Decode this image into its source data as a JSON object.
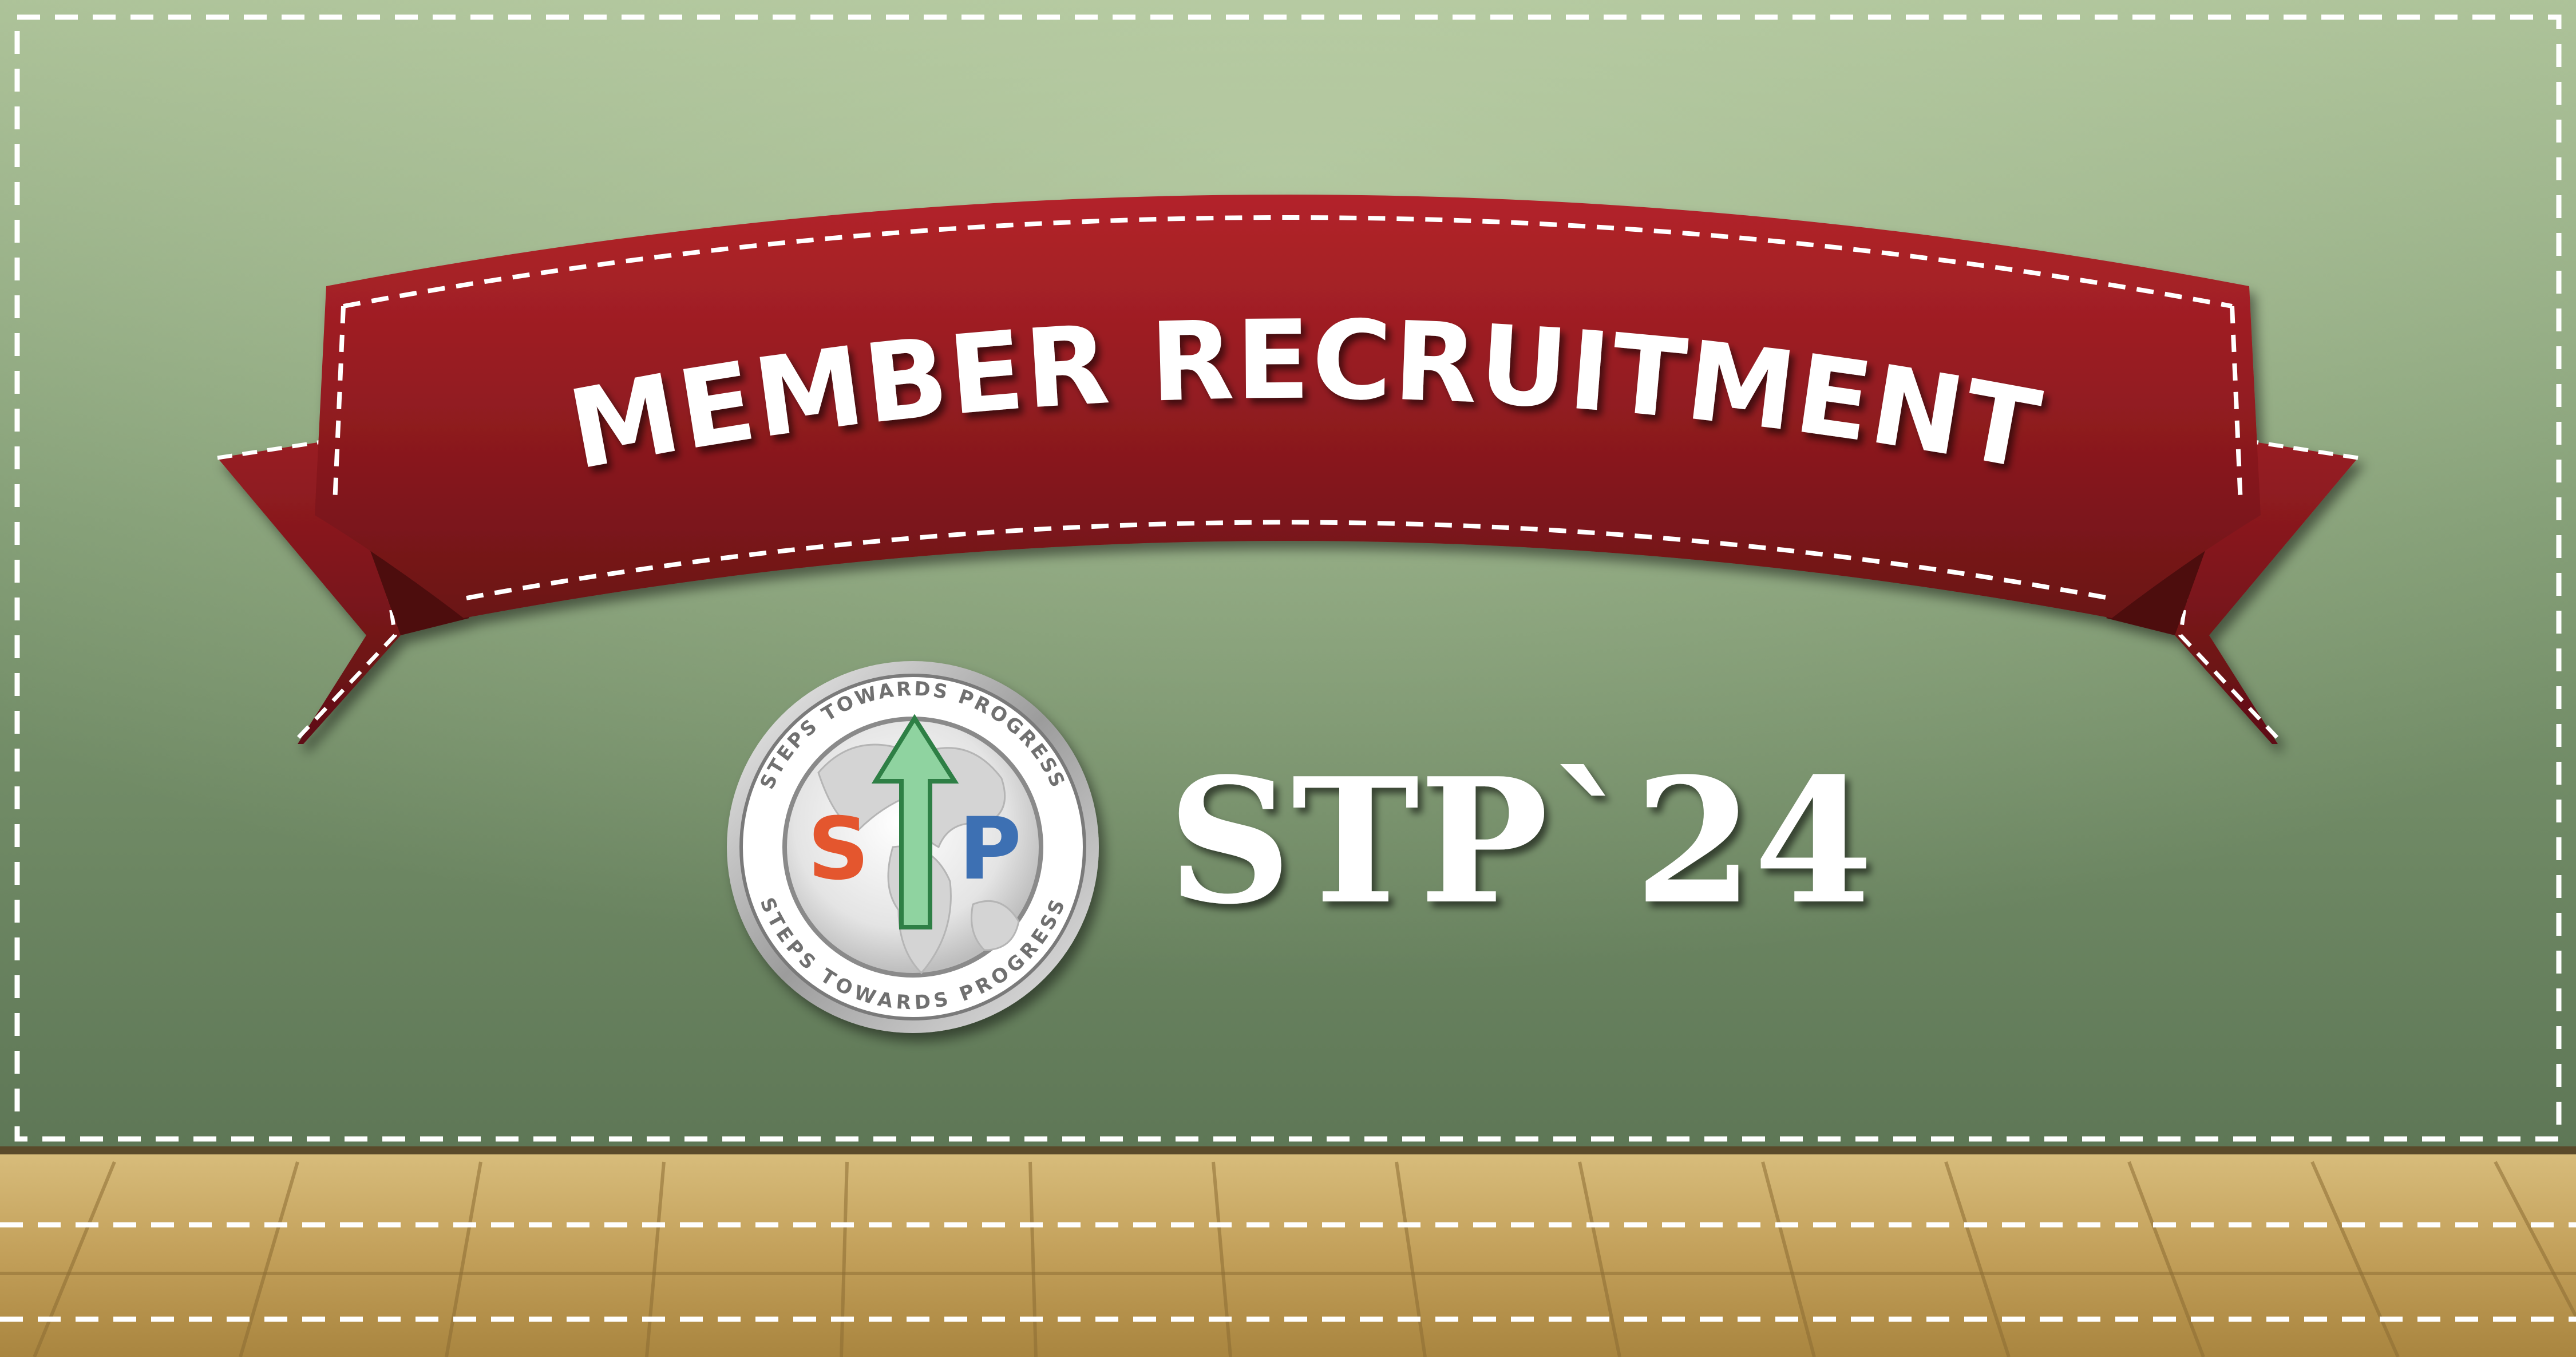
{
  "banner": {
    "title": "MEMBER RECRUITMENT"
  },
  "logo": {
    "ring_text_top": "STEPS TOWARDS PROGRESS",
    "ring_text_bottom": "STEPS TOWARDS PROGRESS",
    "letter_left": "S",
    "letter_right": "P"
  },
  "headline": {
    "text": "STP`24"
  },
  "colors": {
    "background_green": "#6f8a64",
    "banner_red": "#8e1a1f",
    "floor_tan": "#bf9c55",
    "stitch_white": "#ffffff",
    "logo_s_orange": "#e4572e",
    "logo_p_blue": "#3e6fb3",
    "logo_arrow_green": "#8fd3a0"
  },
  "icons": {
    "logo_globe": "globe-icon",
    "logo_arrow": "up-arrow-icon"
  }
}
